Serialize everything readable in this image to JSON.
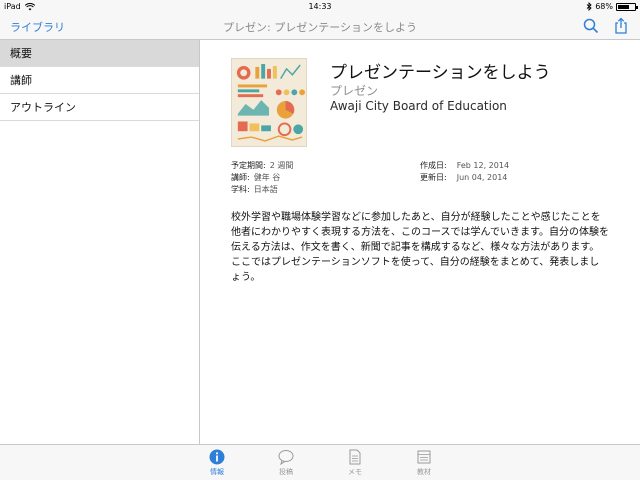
{
  "status": {
    "device": "iPad",
    "time": "14:33",
    "battery": "68%",
    "battery_level": 0.68
  },
  "nav": {
    "back_label": "ライブラリ",
    "title": "プレゼン: プレゼンテーションをしよう",
    "icons": [
      "search-icon",
      "share-icon"
    ]
  },
  "sidebar": {
    "items": [
      {
        "label": "概要",
        "active": true
      },
      {
        "label": "講師",
        "active": false
      },
      {
        "label": "アウトライン",
        "active": false
      }
    ]
  },
  "course": {
    "title": "プレゼンテーションをしよう",
    "subtitle": "プレゼン",
    "organization": "Awaji City Board of Education",
    "meta_left": [
      {
        "label": "予定期間:",
        "value": "2 週間"
      },
      {
        "label": "講師:",
        "value": "健年 谷"
      },
      {
        "label": "学科:",
        "value": "日本語"
      }
    ],
    "meta_right": [
      {
        "label": "作成日:",
        "value": "Feb 12, 2014"
      },
      {
        "label": "更新日:",
        "value": "Jun 04, 2014"
      }
    ],
    "description": "校外学習や職場体験学習などに参加したあと、自分が経験したことや感じたことを他者にわかりやすく表現する方法を、このコースでは学んでいきます。自分の体験を伝える方法は、作文を書く、新聞で記事を構成するなど、様々な方法があります。ここではプレゼンテーションソフトを使って、自分の経験をまとめて、発表しましょう。"
  },
  "tabbar": {
    "tabs": [
      {
        "label": "情報",
        "icon": "info-icon",
        "active": true
      },
      {
        "label": "投稿",
        "icon": "speech-bubble-icon",
        "active": false
      },
      {
        "label": "メモ",
        "icon": "note-icon",
        "active": false
      },
      {
        "label": "教材",
        "icon": "materials-icon",
        "active": false
      }
    ]
  },
  "colors": {
    "accent": "#2f7fd8",
    "sidebar_active": "#d9d9d9",
    "bar_background": "#f7f7f7"
  }
}
